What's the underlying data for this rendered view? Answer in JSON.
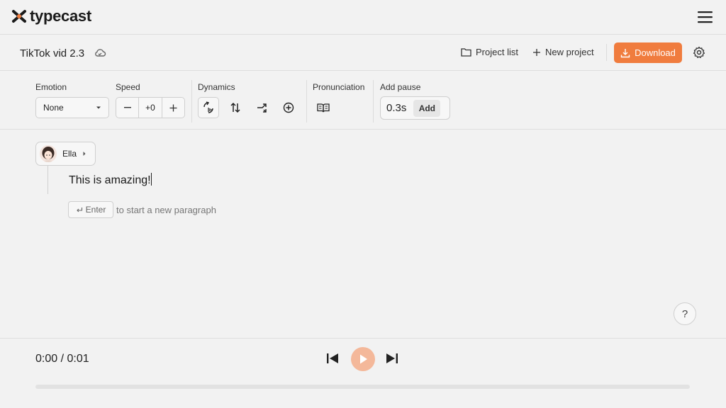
{
  "app": {
    "logo_text": "typecast"
  },
  "project": {
    "title": "TikTok vid 2.3"
  },
  "header": {
    "project_list_label": "Project list",
    "new_project_label": "New project",
    "download_label": "Download",
    "accent_color": "#f07c3e"
  },
  "toolbar": {
    "emotion": {
      "label": "Emotion",
      "value": "None"
    },
    "speed": {
      "label": "Speed",
      "value": "+0",
      "minus": "−",
      "plus": "+"
    },
    "dynamics": {
      "label": "Dynamics"
    },
    "pronunciation": {
      "label": "Pronunciation"
    },
    "pause": {
      "label": "Add pause",
      "value": "0.3s",
      "add_label": "Add"
    }
  },
  "editor": {
    "speaker": {
      "name": "Ella"
    },
    "paragraphs": [
      {
        "text": "This is amazing!"
      }
    ],
    "enter_key_label": "Enter",
    "enter_hint": "to start a new paragraph"
  },
  "help": {
    "label": "?"
  },
  "player": {
    "time": "0:00 / 0:01",
    "progress": 0
  }
}
